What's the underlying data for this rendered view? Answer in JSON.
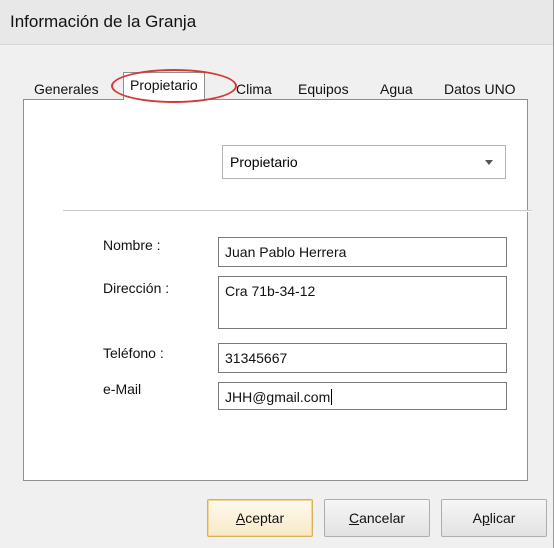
{
  "window": {
    "title": "Información de la Granja"
  },
  "tabs": [
    {
      "label": "Generales"
    },
    {
      "label": "Propietario",
      "active": true
    },
    {
      "label": "Clima"
    },
    {
      "label": "Equipos"
    },
    {
      "label": "Agua"
    },
    {
      "label": "Datos UNO"
    }
  ],
  "owner": {
    "type_selected": "Propietario",
    "fields": {
      "name_label": "Nombre :",
      "name_value": "Juan Pablo Herrera",
      "address_label": "Dirección :",
      "address_value": "Cra 71b-34-12",
      "phone_label": "Teléfono :",
      "phone_value": "31345667",
      "email_label": "e-Mail",
      "email_value": "JHH@gmail.com"
    }
  },
  "buttons": {
    "accept": {
      "mnemonic": "A",
      "rest": "ceptar"
    },
    "cancel": {
      "mnemonic": "C",
      "rest": "ancelar"
    },
    "apply": {
      "pre": "A",
      "mnemonic": "p",
      "rest": "licar"
    }
  },
  "colors": {
    "highlight_ring": "#d23a3a",
    "default_button_border": "#d9b05a"
  }
}
